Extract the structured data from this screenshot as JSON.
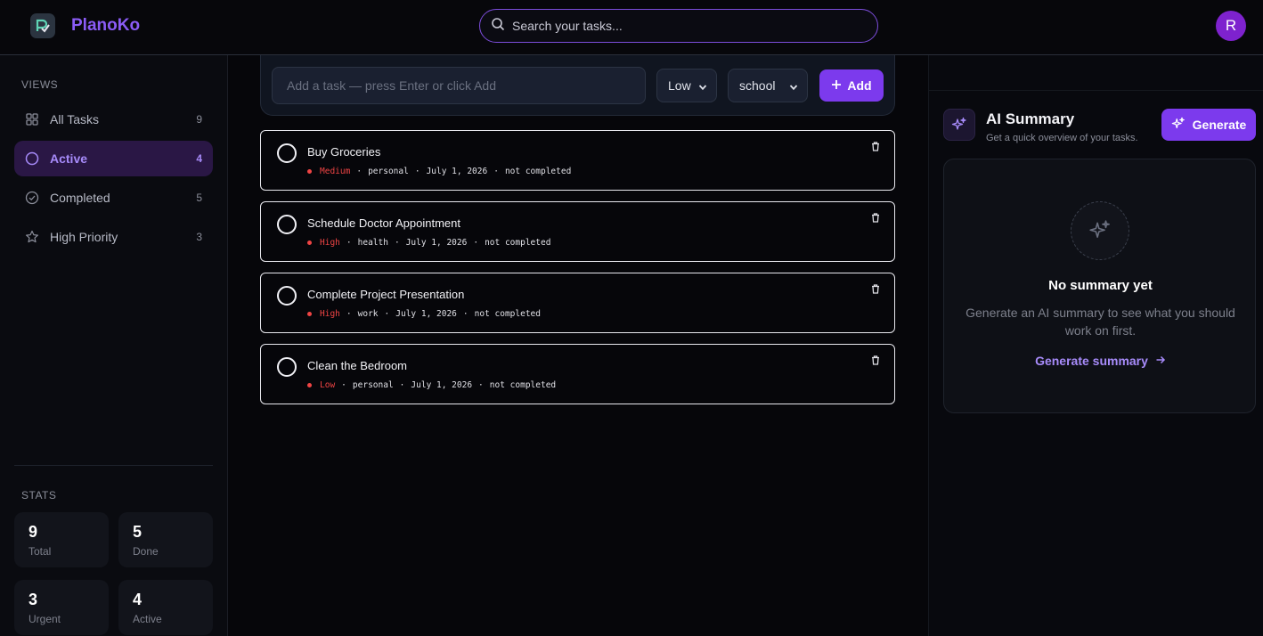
{
  "app": {
    "name": "PlanoKo"
  },
  "header": {
    "search_placeholder": "Search your tasks...",
    "avatar_initial": "R"
  },
  "sidebar": {
    "views_label": "VIEWS",
    "items": [
      {
        "label": "All Tasks",
        "count": "9",
        "icon": "grid-icon"
      },
      {
        "label": "Active",
        "count": "4",
        "icon": "circle-icon"
      },
      {
        "label": "Completed",
        "count": "5",
        "icon": "check-circle-icon"
      },
      {
        "label": "High Priority",
        "count": "3",
        "icon": "star-icon"
      }
    ],
    "stats_label": "STATS",
    "stats": [
      {
        "value": "9",
        "label": "Total"
      },
      {
        "value": "5",
        "label": "Done"
      },
      {
        "value": "3",
        "label": "Urgent"
      },
      {
        "value": "4",
        "label": "Active"
      }
    ]
  },
  "composer": {
    "placeholder": "Add a task — press Enter or click Add",
    "priority": "Low",
    "category": "school",
    "add_label": "Add"
  },
  "tasks": [
    {
      "title": "Buy Groceries",
      "priority": "Medium",
      "category": "personal",
      "date": "July 1, 2026",
      "status": "not completed"
    },
    {
      "title": "Schedule Doctor Appointment",
      "priority": "High",
      "category": "health",
      "date": "July 1, 2026",
      "status": "not completed"
    },
    {
      "title": "Complete Project Presentation",
      "priority": "High",
      "category": "work",
      "date": "July 1, 2026",
      "status": "not completed"
    },
    {
      "title": "Clean the Bedroom",
      "priority": "Low",
      "category": "personal",
      "date": "July 1, 2026",
      "status": "not completed"
    }
  ],
  "ai_summary": {
    "title": "AI Summary",
    "subtitle": "Get a quick overview of your tasks.",
    "generate_label": "Generate",
    "empty_title": "No summary yet",
    "empty_desc": "Generate an AI summary to see what you should work on first.",
    "link_label": "Generate summary"
  },
  "colors": {
    "accent": "#7c3aed",
    "accent_light": "#a78bfa",
    "priority_dot": "#ef4444"
  }
}
